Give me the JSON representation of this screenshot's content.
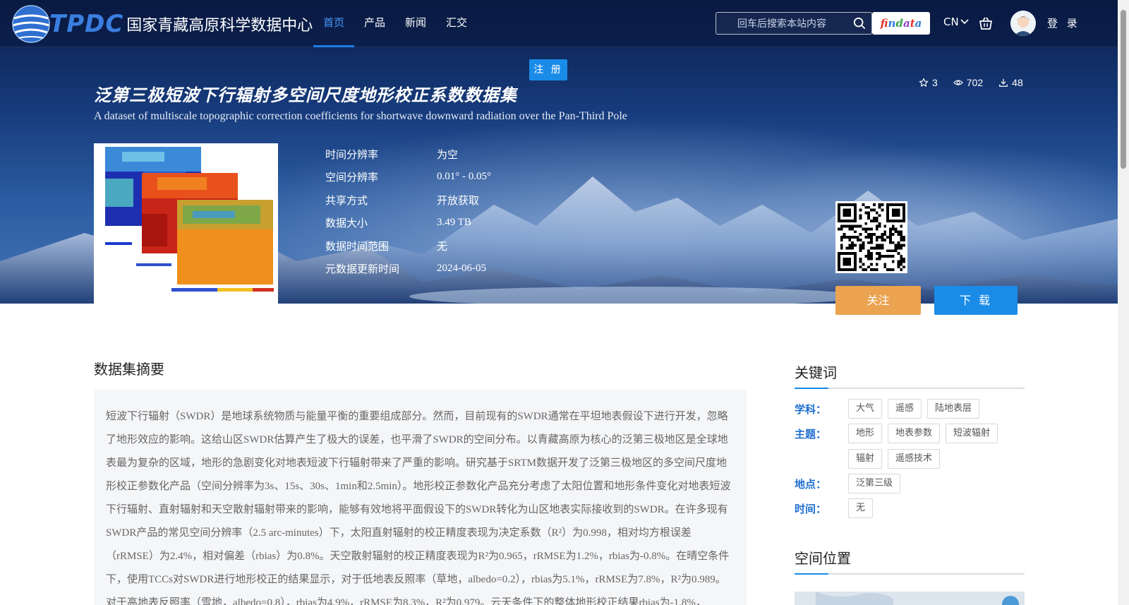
{
  "header": {
    "logo_tpdc": "TPDC",
    "logo_name": "国家青藏高原科学数据中心",
    "nav": [
      {
        "label": "首页",
        "active": true
      },
      {
        "label": "产品",
        "active": false
      },
      {
        "label": "新闻",
        "active": false
      },
      {
        "label": "汇交",
        "active": false
      }
    ],
    "search_placeholder": "回车后搜索本站内容",
    "findata_letters": [
      "f",
      "i",
      "n",
      "d",
      "a",
      "t",
      "a"
    ],
    "lang": "CN",
    "login": "登 录",
    "register": "注 册"
  },
  "dataset": {
    "title_cn": "泛第三极短波下行辐射多空间尺度地形校正系数数据集",
    "title_en": "A dataset of multiscale topographic correction coefficients for shortwave downward radiation over the Pan-Third Pole",
    "stats": {
      "stars": "3",
      "views": "702",
      "downloads": "48"
    },
    "meta": [
      {
        "key": "时间分辨率",
        "value": "为空"
      },
      {
        "key": "空间分辨率",
        "value": "0.01° - 0.05°"
      },
      {
        "key": "共享方式",
        "value": "开放获取"
      },
      {
        "key": "数据大小",
        "value": "3.49 TB"
      },
      {
        "key": "数据时间范围",
        "value": "无"
      },
      {
        "key": "元数据更新时间",
        "value": "2024-06-05"
      }
    ],
    "follow_label": "关注",
    "download_label": "下 载"
  },
  "abstract": {
    "heading": "数据集摘要",
    "text": "短波下行辐射（SWDR）是地球系统物质与能量平衡的重要组成部分。然而，目前现有的SWDR通常在平坦地表假设下进行开发，忽略了地形效应的影响。这给山区SWDR估算产生了极大的误差，也平滑了SWDR的空间分布。以青藏高原为核心的泛第三极地区是全球地表最为复杂的区域，地形的急剧变化对地表短波下行辐射带来了严重的影响。研究基于SRTM数据开发了泛第三极地区的多空间尺度地形校正参数化产品（空间分辨率为3s、15s、30s、1min和2.5min）。地形校正参数化产品充分考虑了太阳位置和地形条件变化对地表短波下行辐射、直射辐射和天空散射辐射带来的影响，能够有效地将平面假设下的SWDR转化为山区地表实际接收到的SWDR。在许多现有SWDR产品的常见空间分辨率（2.5 arc-minutes）下，太阳直射辐射的校正精度表现为决定系数（R²）为0.998，相对均方根误差（rRMSE）为2.4%，相对偏差（rbias）为0.8%。天空散射辐射的校正精度表现为R²为0.965，rRMSE为1.2%，rbias为-0.8%。在晴空条件下，使用TCCs对SWDR进行地形校正的结果显示，对于低地表反照率（草地，albedo=0.2），rbias为5.1%，rRMSE为7.8%，R²为0.989。对于高地表反照率（雪地，albedo=0.8），rbias为4.9%，rRMSE为8.3%，R²为0.979。云天条件下的整体地形校正结果rbias为-1.8%，"
  },
  "keywords": {
    "heading": "关键词",
    "rows": [
      {
        "label": "学科：",
        "tags": [
          "大气",
          "遥感",
          "陆地表层"
        ]
      },
      {
        "label": "主题：",
        "tags": [
          "地形",
          "地表参数",
          "短波辐射",
          "辐射",
          "遥感技术"
        ]
      },
      {
        "label": "地点：",
        "tags": [
          "泛第三级"
        ]
      },
      {
        "label": "时间：",
        "tags": [
          "无"
        ]
      }
    ]
  },
  "spatial": {
    "heading": "空间位置"
  },
  "colors": {
    "accent_blue": "#1a8ce8",
    "follow_orange": "#eba350",
    "keyword_label": "#1e6ed0"
  }
}
